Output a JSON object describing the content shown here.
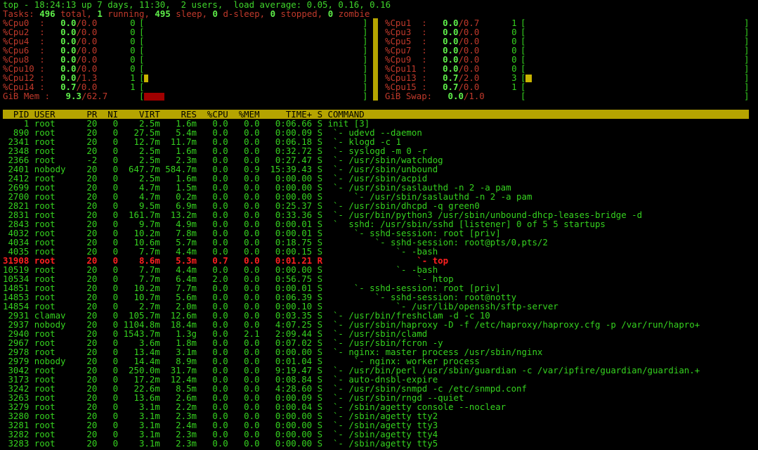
{
  "summary": {
    "title_line": "top - 18:24:13 up 7 days, 11:30,  2 users,  load average: 0.05, 0.16, 0.16",
    "tasks_label": "Tasks:",
    "tasks_total": "496",
    "total_label": "total,",
    "tasks_running": "1",
    "running_label": "running,",
    "tasks_sleep": "495",
    "sleep_label": "sleep,",
    "tasks_dsleep": "0",
    "dsleep_label": "d-sleep,",
    "tasks_stopped": "0",
    "stopped_label": "stopped,",
    "tasks_zombie": "0",
    "zombie_label": "zombie"
  },
  "cpu_left": [
    {
      "label": "%Cpu0  :",
      "val": "0.0",
      "max": "/0.0",
      "pct": "0",
      "fill": 0
    },
    {
      "label": "%Cpu2  :",
      "val": "0.0",
      "max": "/0.0",
      "pct": "0",
      "fill": 0
    },
    {
      "label": "%Cpu4  :",
      "val": "0.0",
      "max": "/0.0",
      "pct": "0",
      "fill": 0
    },
    {
      "label": "%Cpu6  :",
      "val": "0.0",
      "max": "/0.0",
      "pct": "0",
      "fill": 0
    },
    {
      "label": "%Cpu8  :",
      "val": "0.0",
      "max": "/0.0",
      "pct": "0",
      "fill": 0
    },
    {
      "label": "%Cpu10 :",
      "val": "0.0",
      "max": "/0.0",
      "pct": "0",
      "fill": 0
    },
    {
      "label": "%Cpu12 :",
      "val": "0.0",
      "max": "/1.3",
      "pct": "1",
      "fill": 0.013
    },
    {
      "label": "%Cpu14 :",
      "val": "0.7",
      "max": "/0.0",
      "pct": "1",
      "fill": 0
    }
  ],
  "cpu_right": [
    {
      "label": "%Cpu1  :",
      "val": "0.0",
      "max": "/0.7",
      "pct": "1",
      "fill": 0
    },
    {
      "label": "%Cpu3  :",
      "val": "0.0",
      "max": "/0.0",
      "pct": "0",
      "fill": 0
    },
    {
      "label": "%Cpu5  :",
      "val": "0.0",
      "max": "/0.0",
      "pct": "0",
      "fill": 0
    },
    {
      "label": "%Cpu7  :",
      "val": "0.0",
      "max": "/0.0",
      "pct": "0",
      "fill": 0
    },
    {
      "label": "%Cpu9  :",
      "val": "0.0",
      "max": "/0.0",
      "pct": "0",
      "fill": 0
    },
    {
      "label": "%Cpu11 :",
      "val": "0.0",
      "max": "/0.0",
      "pct": "0",
      "fill": 0
    },
    {
      "label": "%Cpu13 :",
      "val": "0.7",
      "max": "/2.0",
      "pct": "3",
      "fill": 0.027
    },
    {
      "label": "%Cpu15 :",
      "val": "0.7",
      "max": "/0.0",
      "pct": "1",
      "fill": 0
    }
  ],
  "mem": {
    "label": "GiB Mem :",
    "val": "9.3",
    "max": "/62.7",
    "fill": 0.093
  },
  "swap": {
    "label": "GiB Swap:",
    "val": "0.0",
    "max": "/1.0",
    "fill": 0
  },
  "colors": {
    "bar_fill": "#c8b400",
    "mem_fill": "#a00000",
    "separator": "#b5a400",
    "text": "#35d21f",
    "highlight": "#ff2020"
  },
  "header": "  PID USER      PR  NI    VIRT    RES  %CPU  %MEM     TIME+ S COMMAND",
  "processes": [
    "    1 root      20   0    2.5m   1.6m   0.0   0.0   0:06.66 S init [3]",
    "  890 root      20   0   27.5m   5.4m   0.0   0.0   0:00.09 S  `- udevd --daemon",
    " 2341 root      20   0   12.7m  11.7m   0.0   0.0   0:06.18 S  `- klogd -c 1",
    " 2348 root      20   0    2.5m   1.6m   0.0   0.0   0:32.72 S  `- syslogd -m 0 -r",
    " 2366 root      -2   0    2.5m   2.3m   0.0   0.0   0:27.47 S  `- /usr/sbin/watchdog",
    " 2401 nobody    20   0  647.7m 584.7m   0.0   0.9  15:39.43 S  `- /usr/sbin/unbound",
    " 2412 root      20   0    2.5m   1.6m   0.0   0.0   0:00.00 S  `- /usr/sbin/acpid",
    " 2699 root      20   0    4.7m   1.5m   0.0   0.0   0:00.00 S  `- /usr/sbin/saslauthd -n 2 -a pam",
    " 2700 root      20   0    4.7m   0.2m   0.0   0.0   0:00.00 S      `- /usr/sbin/saslauthd -n 2 -a pam",
    " 2821 root      20   0    9.5m   6.9m   0.0   0.0   0:25.37 S  `- /usr/sbin/dhcpd -q green0",
    " 2831 root      20   0  161.7m  13.2m   0.0   0.0   0:33.36 S  `- /usr/bin/python3 /usr/sbin/unbound-dhcp-leases-bridge -d",
    " 2843 root      20   0    9.7m   4.9m   0.0   0.0   0:00.01 S  `  sshd: /usr/sbin/sshd [listener] 0 of 5 5 startups",
    " 4032 root      20   0   10.2m   7.8m   0.0   0.0   0:00.01 S      `- sshd-session: root [priv]",
    " 4034 root      20   0   10.6m   5.7m   0.0   0.0   0:18.75 S          `- sshd-session: root@pts/0,pts/2",
    " 4035 root      20   0    7.7m   4.4m   0.0   0.0   0:00.15 S              `- -bash",
    "31908 root      20   0    8.6m   5.3m   0.7   0.0   0:01.21 R                  `- top",
    "10519 root      20   0    7.7m   4.4m   0.0   0.0   0:00.00 S              `- -bash",
    "10534 root      20   0    7.7m   6.4m   2.0   0.0   0:56.75 S                  `- htop",
    "14851 root      20   0   10.2m   7.7m   0.0   0.0   0:00.01 S      `- sshd-session: root [priv]",
    "14853 root      20   0   10.7m   5.6m   0.0   0.0   0:06.39 S          `- sshd-session: root@notty",
    "14854 root      20   0    2.7m   2.0m   0.0   0.0   0:00.10 S              `- /usr/lib/openssh/sftp-server",
    " 2931 clamav    20   0  105.7m  12.6m   0.0   0.0   0:03.35 S  `- /usr/bin/freshclam -d -c 10",
    " 2937 nobody    20   0 1104.8m  18.4m   0.0   0.0   4:07.25 S  `- /usr/sbin/haproxy -D -f /etc/haproxy/haproxy.cfg -p /var/run/hapro+",
    " 2940 root      20   0 1543.7m   1.3g   0.0   2.1   2:09.44 S  `- /usr/sbin/clamd",
    " 2967 root      20   0    3.6m   1.8m   0.0   0.0   0:07.02 S  `- /usr/sbin/fcron -y",
    " 2978 root      20   0   13.4m   3.1m   0.0   0.0   0:00.00 S  `- nginx: master process /usr/sbin/nginx",
    " 2979 nobody    20   0   14.4m   8.9m   0.0   0.0   0:01.04 S      `- nginx: worker process",
    " 3042 root      20   0  250.0m  31.7m   0.0   0.0   9:19.47 S  `- /usr/bin/perl /usr/sbin/guardian -c /var/ipfire/guardian/guardian.+",
    " 3173 root      20   0   17.2m  12.4m   0.0   0.0   0:08.84 S  `- auto-dnsbl-expire",
    " 3242 root      20   0   22.6m   8.5m   0.0   0.0   4:28.60 S  `- /usr/sbin/snmpd -c /etc/snmpd.conf",
    " 3263 root      20   0   13.6m   2.6m   0.0   0.0   0:00.09 S  `- /usr/sbin/rngd --quiet",
    " 3279 root      20   0    3.1m   2.2m   0.0   0.0   0:00.04 S  `- /sbin/agetty console --noclear",
    " 3280 root      20   0    3.1m   2.3m   0.0   0.0   0:00.00 S  `- /sbin/agetty tty2",
    " 3281 root      20   0    3.1m   2.4m   0.0   0.0   0:00.00 S  `- /sbin/agetty tty3",
    " 3282 root      20   0    3.1m   2.3m   0.0   0.0   0:00.00 S  `- /sbin/agetty tty4",
    " 3283 root      20   0    3.1m   2.3m   0.0   0.0   0:00.00 S  `- /sbin/agetty tty5"
  ]
}
